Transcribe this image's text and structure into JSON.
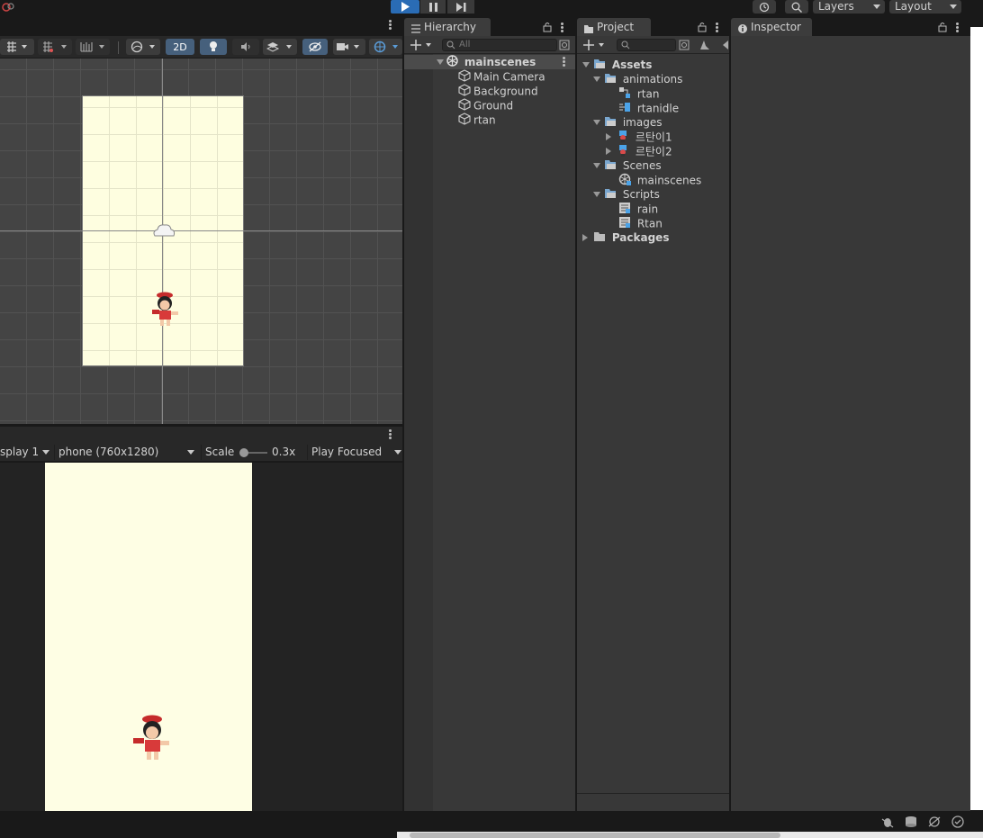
{
  "topbar": {
    "layers_label": "Layers",
    "layout_label": "Layout"
  },
  "scene": {
    "mode_2d_label": "2D"
  },
  "game": {
    "display_label": "splay 1",
    "resolution_label": "phone (760x1280)",
    "scale_label": "Scale",
    "scale_value": "0.3x",
    "play_mode_label": "Play Focused",
    "canvas_color": "#fefee4"
  },
  "hierarchy": {
    "tab_label": "Hierarchy",
    "search_placeholder": "All",
    "scene_name": "mainscenes",
    "objects": [
      "Main Camera",
      "Background",
      "Ground",
      "rtan"
    ]
  },
  "project": {
    "tab_label": "Project",
    "root": "Assets",
    "items": [
      {
        "label": "animations"
      },
      {
        "label": "rtan"
      },
      {
        "label": "rtanidle"
      },
      {
        "label": "images"
      },
      {
        "label": "르탄이1"
      },
      {
        "label": "르탄이2"
      },
      {
        "label": "Scenes"
      },
      {
        "label": "mainscenes"
      },
      {
        "label": "Scripts"
      },
      {
        "label": "rain"
      },
      {
        "label": "Rtan"
      },
      {
        "label": "Packages"
      }
    ]
  },
  "inspector": {
    "tab_label": "Inspector"
  },
  "colors": {
    "accent": "#2a6cb5",
    "scene_bg": "#444444",
    "canvas": "#fefee0"
  }
}
